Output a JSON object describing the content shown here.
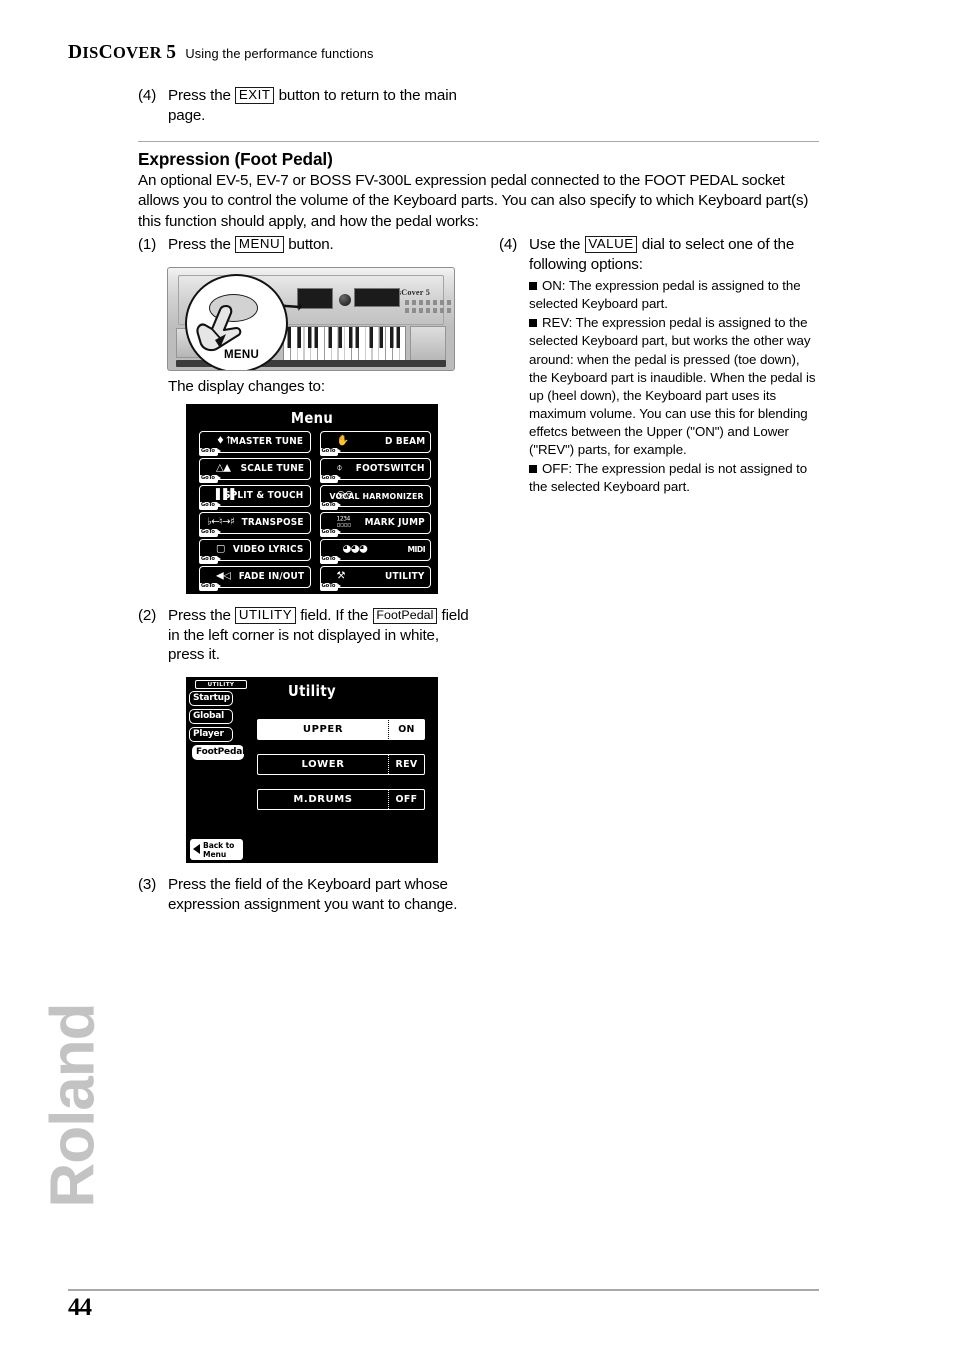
{
  "header": {
    "brand_cap": "D",
    "brand_rest": "IS",
    "brand_cap2": "C",
    "brand_rest2": "OVER",
    "brand_num": "5",
    "brand_full": "DisCover 5",
    "subtitle": "Using the performance functions"
  },
  "step_top": {
    "num": "(4)",
    "text_before": "Press the",
    "keycap": "EXIT",
    "text_after": "button to return to the main page."
  },
  "section": {
    "title": "Expression (Foot Pedal)",
    "intro": "An optional EV-5, EV-7 or BOSS FV-300L expression pedal connected to the FOOT PEDAL socket allows you to control the volume of the Keyboard parts. You can also specify to which Keyboard part(s) this function should apply, and how the pedal works:"
  },
  "steps": {
    "one": {
      "num": "(1)",
      "text_before": "Press the",
      "keycap": "MENU",
      "text_after": "button."
    },
    "display_changes": "The display changes to:",
    "two": {
      "num": "(2)",
      "text_before": "Press the",
      "keycap1": "UTILITY",
      "text_mid": "field. If the",
      "keycap2": "FootPedal",
      "text_after": "field in the left corner is not displayed in white, press it."
    },
    "three": {
      "num": "(3)",
      "text": "Press the field of the Keyboard part whose expression assignment you want to change."
    },
    "four": {
      "num": "(4)",
      "text_before": "Use the",
      "keycap": "VALUE",
      "text_after": "dial to select one of the following options:",
      "options": [
        {
          "name": "ON:",
          "desc": "The expression pedal is assigned to the selected Keyboard part."
        },
        {
          "name": "REV:",
          "desc": "The expression pedal is assigned to the selected Keyboard part, but works the other way around: when the pedal is pressed (toe down), the Keyboard part is inaudible. When the pedal is up (heel down), the Keyboard part uses its maximum volume. You can use this for blending effetcs between the Upper (\"ON\") and Lower (\"REV\") parts, for example."
        },
        {
          "name": "OFF:",
          "desc": "The expression pedal is not assigned to the selected Keyboard part."
        }
      ]
    }
  },
  "keyboard_photo": {
    "brand": "Roland",
    "model": "DisCover 5",
    "callout_label": "MENU"
  },
  "menu_screen": {
    "title": "Menu",
    "goto_tag": "GoTo",
    "buttons": [
      {
        "label": "MASTER TUNE",
        "icon": "tuning-fork-icon",
        "glyph": "Ψ"
      },
      {
        "label": "D BEAM",
        "icon": "hand-beam-icon",
        "glyph": "✋"
      },
      {
        "label": "SCALE TUNE",
        "icon": "camel-icon",
        "glyph": "▲"
      },
      {
        "label": "FOOTSWITCH",
        "icon": "footswitch-pedal-icon",
        "glyph": "▱"
      },
      {
        "label": "SPLIT & TOUCH",
        "icon": "keyboard-split-icon",
        "glyph": "░"
      },
      {
        "label": "VOCAL HARMONIZER",
        "icon": "microphone-harmonizer-icon",
        "glyph": "∞"
      },
      {
        "label": "TRANSPOSE",
        "icon": "flat-natural-sharp-icon",
        "glyph": "♭←♮→♯"
      },
      {
        "label": "MARK JUMP",
        "icon": "numbered-marks-icon",
        "glyph": "1234"
      },
      {
        "label": "VIDEO LYRICS",
        "icon": "monitor-icon",
        "glyph": "▭"
      },
      {
        "label": "MIDI",
        "icon": "midi-connectors-icon",
        "glyph": "⊙⊙⊙"
      },
      {
        "label": "FADE IN/OUT",
        "icon": "speaker-fade-icon",
        "glyph": "◂▸"
      },
      {
        "label": "UTILITY",
        "icon": "tools-icon",
        "glyph": "⚒"
      }
    ]
  },
  "utility_screen": {
    "title": "Utility",
    "tab_header": "UTILITY",
    "tabs": [
      {
        "label": "Startup",
        "active": false
      },
      {
        "label": "Global",
        "active": false
      },
      {
        "label": "Player",
        "active": false
      },
      {
        "label": "FootPedal",
        "active": true
      }
    ],
    "rows": [
      {
        "name": "UPPER",
        "value": "ON",
        "selected": true
      },
      {
        "name": "LOWER",
        "value": "REV",
        "selected": false
      },
      {
        "name": "M.DRUMS",
        "value": "OFF",
        "selected": false
      }
    ],
    "back_label_line1": "Back to",
    "back_label_line2": "Menu"
  },
  "footer": {
    "watermark": "Roland",
    "page_number": "44"
  }
}
